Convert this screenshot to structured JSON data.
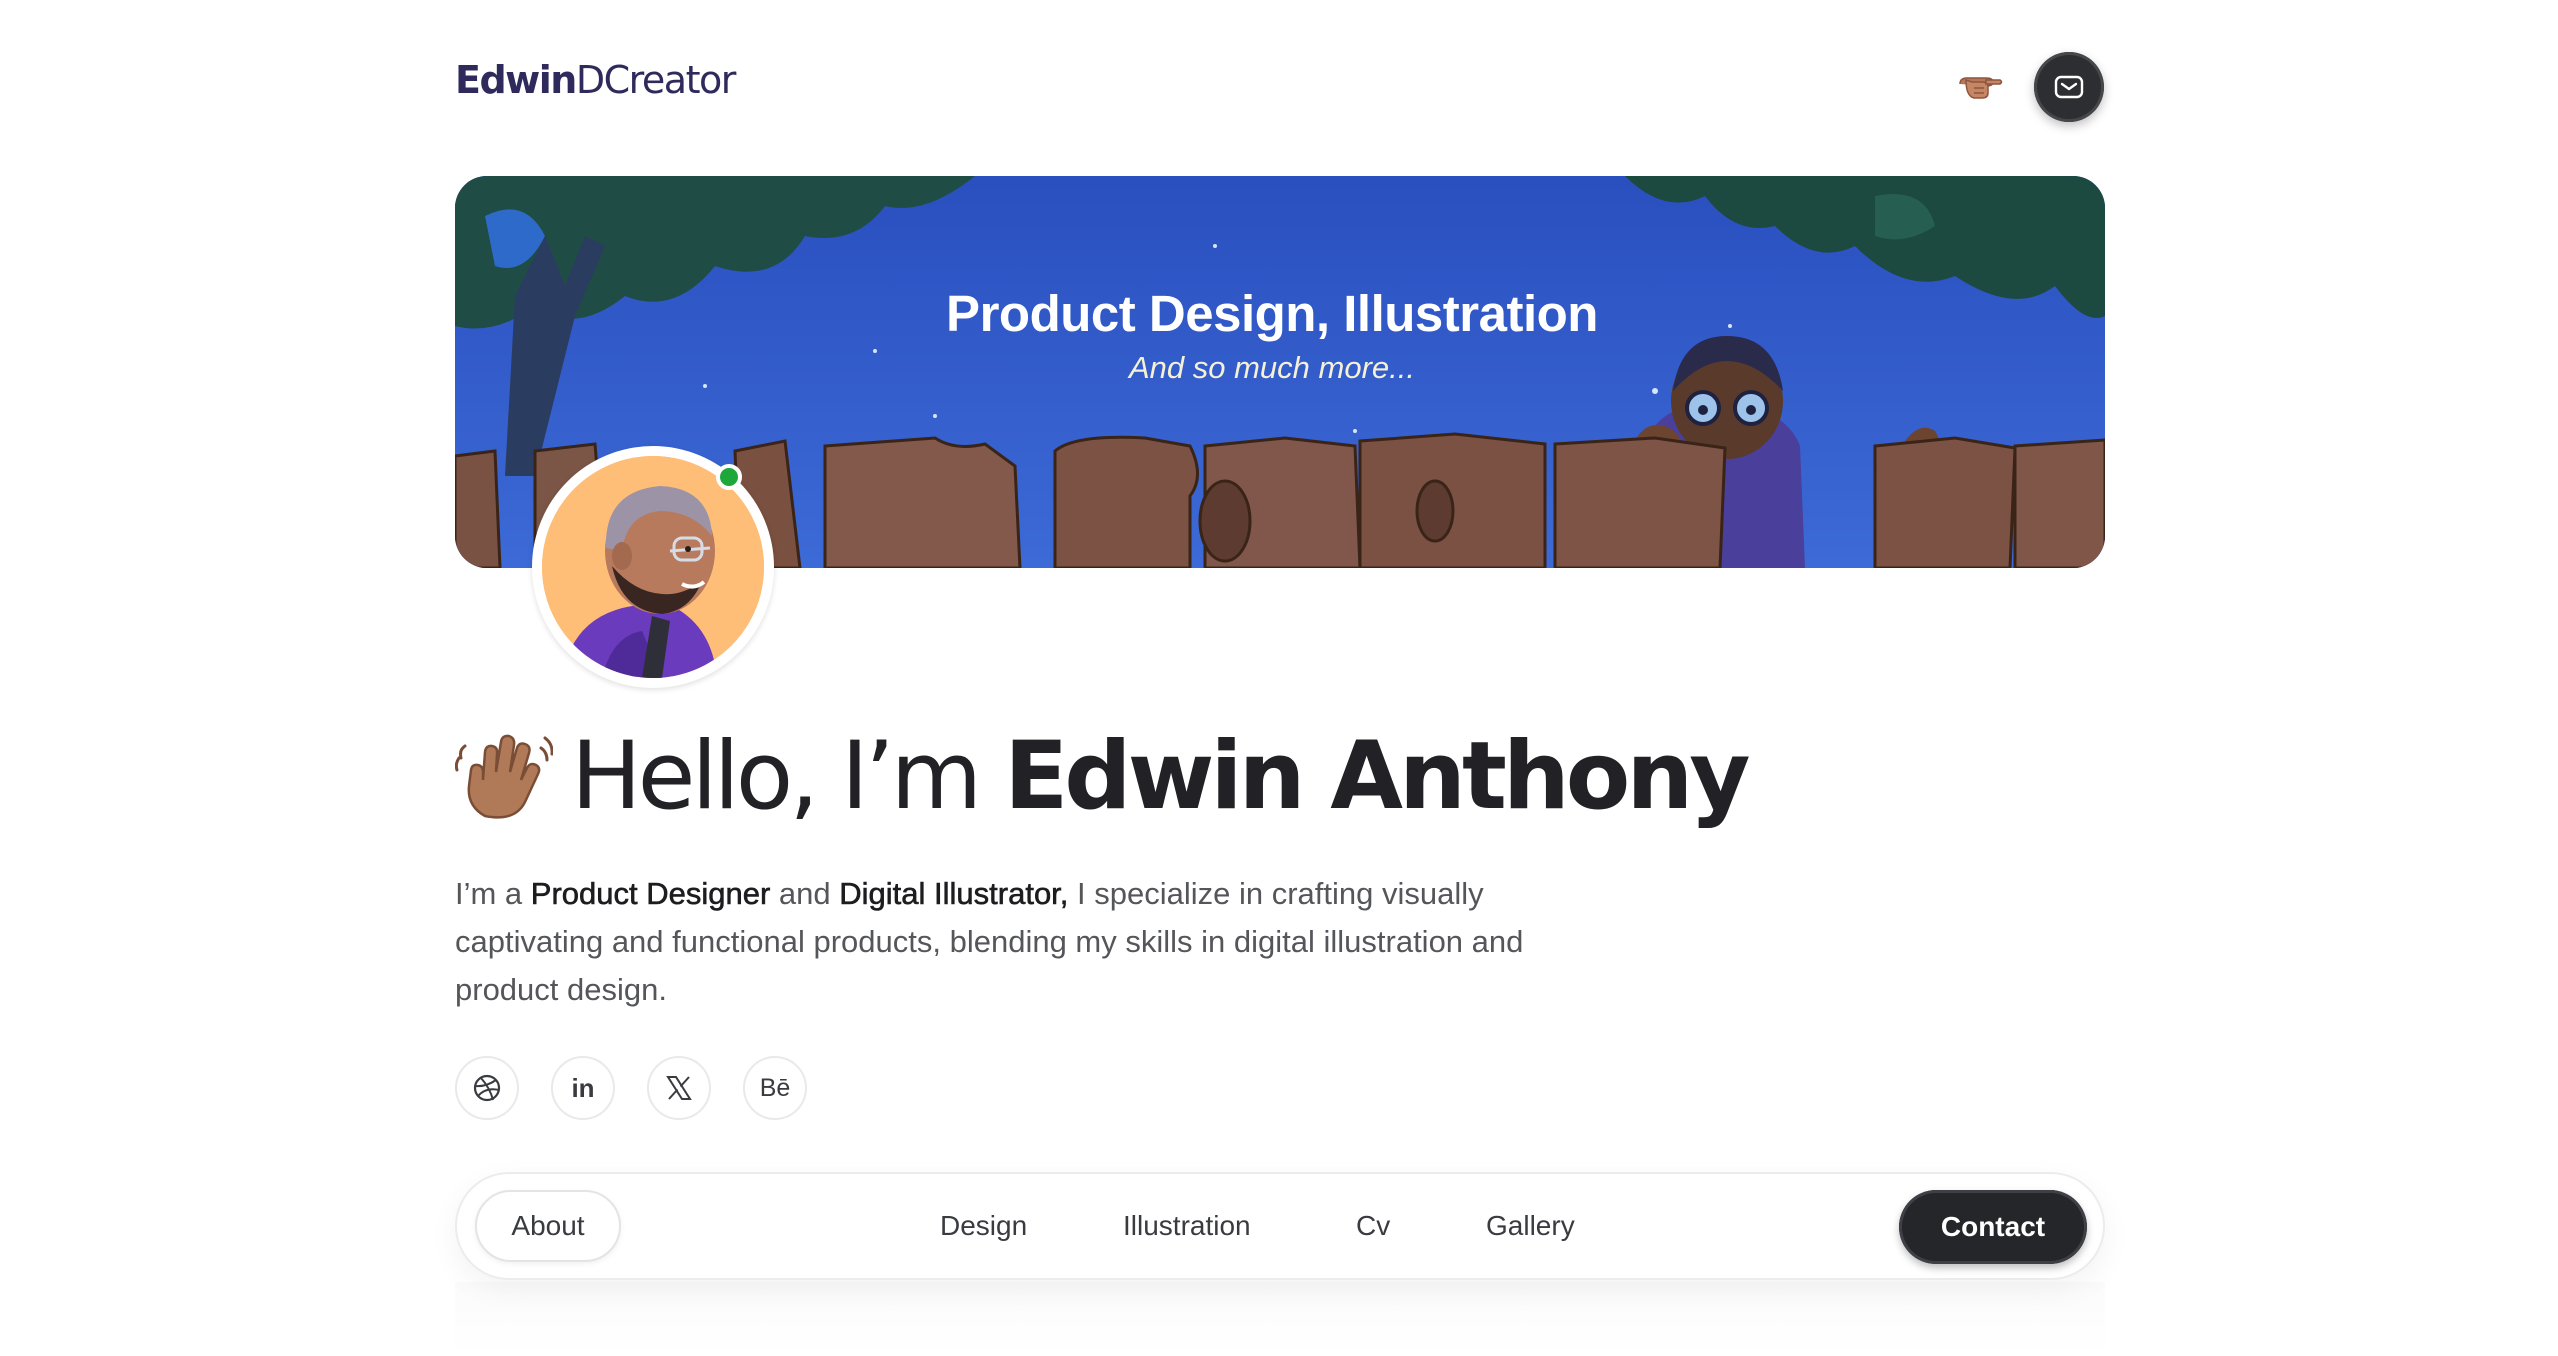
{
  "header": {
    "logo_bold": "Edwin",
    "logo_light": "DCreator",
    "pointer_icon": "backhand-index-pointing-right-icon",
    "mail_icon": "envelope-icon"
  },
  "banner": {
    "title": "Product Design, Illustration",
    "subtitle": "And so much more..."
  },
  "profile": {
    "status": "online",
    "status_color": "#1fa83a"
  },
  "hero": {
    "wave_icon": "waving-hand-icon",
    "greeting": "Hello, I’m ",
    "name": "Edwin Anthony"
  },
  "intro": {
    "p1": "I’m a ",
    "role1": "Product Designer",
    "p2": " and ",
    "role2": "Digital Illustrator,",
    "p3": " I specialize in crafting visually captivating and functional products, blending my skills in digital illustration and product design."
  },
  "socials": [
    {
      "name": "dribbble",
      "icon": "dribbble-icon"
    },
    {
      "name": "linkedin",
      "label": "in",
      "icon": "linkedin-icon"
    },
    {
      "name": "x",
      "icon": "x-icon"
    },
    {
      "name": "behance",
      "label": "Bē",
      "icon": "behance-icon"
    }
  ],
  "nav": {
    "about": "About",
    "items": [
      "Design",
      "Illustration",
      "Cv",
      "Gallery"
    ],
    "contact": "Contact"
  },
  "colors": {
    "brand": "#2f2a5c",
    "dark_button": "#25262a",
    "banner_sky": "#2f58c4"
  }
}
